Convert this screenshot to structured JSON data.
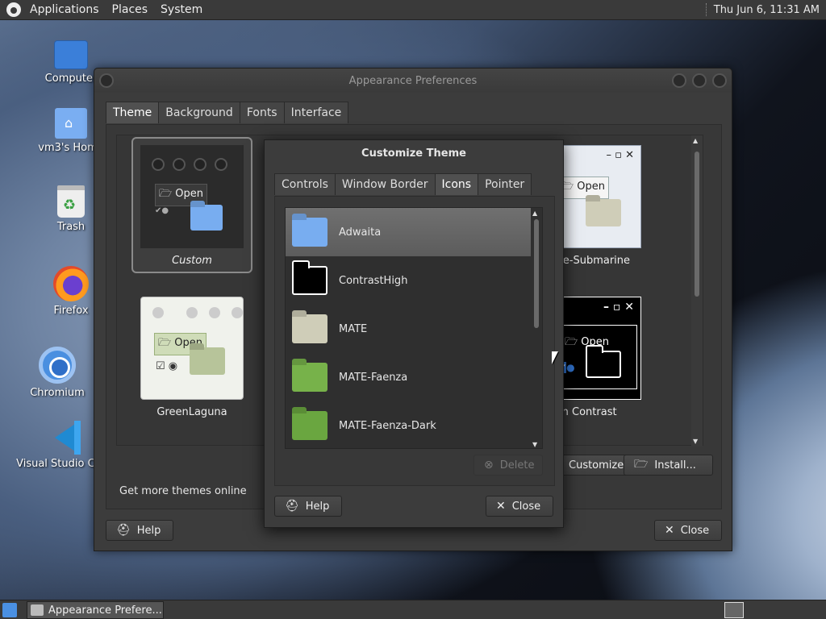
{
  "top_panel": {
    "menus": [
      "Applications",
      "Places",
      "System"
    ],
    "clock": "Thu Jun  6, 11:31 AM"
  },
  "desktop": {
    "icons": [
      {
        "label": "Computer",
        "icon": "computer-icon"
      },
      {
        "label": "vm3's Home",
        "icon": "home-folder-icon"
      },
      {
        "label": "Trash",
        "icon": "trash-icon"
      },
      {
        "label": "Firefox",
        "icon": "firefox-icon"
      },
      {
        "label": "Chromium",
        "icon": "chromium-icon"
      },
      {
        "label": "Visual Studio Code",
        "icon": "vscode-icon"
      }
    ]
  },
  "appearance_window": {
    "title": "Appearance Preferences",
    "tabs": [
      "Theme",
      "Background",
      "Fonts",
      "Interface"
    ],
    "active_tab": "Theme",
    "themes": [
      {
        "name": "Custom",
        "selected": true
      },
      {
        "name": "Blue-Submarine"
      },
      {
        "name": "GreenLaguna"
      },
      {
        "name": "High Contrast"
      }
    ],
    "preview_open_label": "Open",
    "get_more_link": "Get more themes online",
    "customize_button": "Customize...",
    "install_button": "Install...",
    "help_button": "Help",
    "close_button": "Close"
  },
  "customize_dialog": {
    "title": "Customize Theme",
    "tabs": [
      "Controls",
      "Window Border",
      "Icons",
      "Pointer"
    ],
    "active_tab": "Icons",
    "icon_themes": [
      {
        "name": "Adwaita",
        "selected": true
      },
      {
        "name": "ContrastHigh"
      },
      {
        "name": "MATE"
      },
      {
        "name": "MATE-Faenza"
      },
      {
        "name": "MATE-Faenza-Dark"
      }
    ],
    "delete_button": "Delete",
    "help_button": "Help",
    "close_button": "Close"
  },
  "taskbar": {
    "window_button": "Appearance Prefere..."
  },
  "colors": {
    "panel_bg": "#3a3a3a",
    "window_bg": "#3c3c3c",
    "selection": "#6a6a6a",
    "folder_blue": "#78adf0",
    "folder_green": "#77b24a"
  }
}
